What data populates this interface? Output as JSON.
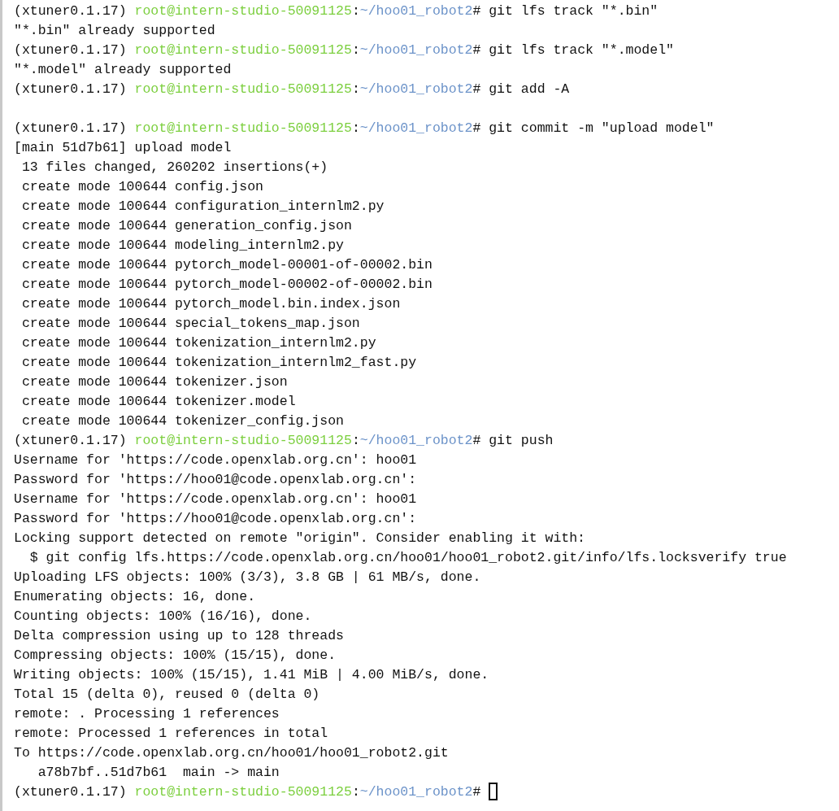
{
  "terminal": {
    "lines": [
      {
        "kind": "prompt",
        "env": "(xtuner0.1.17)",
        "user_host": "root@intern-studio-50091125",
        "separator": ":",
        "cwd": "~/hoo01_robot2",
        "symbol": "#",
        "command": "git lfs track \"*.bin\"",
        "cursor": false
      },
      {
        "kind": "output",
        "text": "\"*.bin\" already supported"
      },
      {
        "kind": "prompt",
        "env": "(xtuner0.1.17)",
        "user_host": "root@intern-studio-50091125",
        "separator": ":",
        "cwd": "~/hoo01_robot2",
        "symbol": "#",
        "command": "git lfs track \"*.model\"",
        "cursor": false
      },
      {
        "kind": "output",
        "text": "\"*.model\" already supported"
      },
      {
        "kind": "prompt",
        "env": "(xtuner0.1.17)",
        "user_host": "root@intern-studio-50091125",
        "separator": ":",
        "cwd": "~/hoo01_robot2",
        "symbol": "#",
        "command": "git add -A",
        "cursor": false
      },
      {
        "kind": "blank"
      },
      {
        "kind": "prompt",
        "env": "(xtuner0.1.17)",
        "user_host": "root@intern-studio-50091125",
        "separator": ":",
        "cwd": "~/hoo01_robot2",
        "symbol": "#",
        "command": "git commit -m \"upload model\"",
        "cursor": false
      },
      {
        "kind": "output",
        "text": "[main 51d7b61] upload model"
      },
      {
        "kind": "output",
        "text": " 13 files changed, 260202 insertions(+)"
      },
      {
        "kind": "output",
        "text": " create mode 100644 config.json"
      },
      {
        "kind": "output",
        "text": " create mode 100644 configuration_internlm2.py"
      },
      {
        "kind": "output",
        "text": " create mode 100644 generation_config.json"
      },
      {
        "kind": "output",
        "text": " create mode 100644 modeling_internlm2.py"
      },
      {
        "kind": "output",
        "text": " create mode 100644 pytorch_model-00001-of-00002.bin"
      },
      {
        "kind": "output",
        "text": " create mode 100644 pytorch_model-00002-of-00002.bin"
      },
      {
        "kind": "output",
        "text": " create mode 100644 pytorch_model.bin.index.json"
      },
      {
        "kind": "output",
        "text": " create mode 100644 special_tokens_map.json"
      },
      {
        "kind": "output",
        "text": " create mode 100644 tokenization_internlm2.py"
      },
      {
        "kind": "output",
        "text": " create mode 100644 tokenization_internlm2_fast.py"
      },
      {
        "kind": "output",
        "text": " create mode 100644 tokenizer.json"
      },
      {
        "kind": "output",
        "text": " create mode 100644 tokenizer.model"
      },
      {
        "kind": "output",
        "text": " create mode 100644 tokenizer_config.json"
      },
      {
        "kind": "prompt",
        "env": "(xtuner0.1.17)",
        "user_host": "root@intern-studio-50091125",
        "separator": ":",
        "cwd": "~/hoo01_robot2",
        "symbol": "#",
        "command": "git push",
        "cursor": false
      },
      {
        "kind": "output",
        "text": "Username for 'https://code.openxlab.org.cn': hoo01"
      },
      {
        "kind": "output",
        "text": "Password for 'https://hoo01@code.openxlab.org.cn':"
      },
      {
        "kind": "output",
        "text": "Username for 'https://code.openxlab.org.cn': hoo01"
      },
      {
        "kind": "output",
        "text": "Password for 'https://hoo01@code.openxlab.org.cn':"
      },
      {
        "kind": "output",
        "text": "Locking support detected on remote \"origin\". Consider enabling it with:"
      },
      {
        "kind": "output",
        "text": "  $ git config lfs.https://code.openxlab.org.cn/hoo01/hoo01_robot2.git/info/lfs.locksverify true"
      },
      {
        "kind": "output",
        "text": "Uploading LFS objects: 100% (3/3), 3.8 GB | 61 MB/s, done."
      },
      {
        "kind": "output",
        "text": "Enumerating objects: 16, done."
      },
      {
        "kind": "output",
        "text": "Counting objects: 100% (16/16), done."
      },
      {
        "kind": "output",
        "text": "Delta compression using up to 128 threads"
      },
      {
        "kind": "output",
        "text": "Compressing objects: 100% (15/15), done."
      },
      {
        "kind": "output",
        "text": "Writing objects: 100% (15/15), 1.41 MiB | 4.00 MiB/s, done."
      },
      {
        "kind": "output",
        "text": "Total 15 (delta 0), reused 0 (delta 0)"
      },
      {
        "kind": "output",
        "text": "remote: . Processing 1 references"
      },
      {
        "kind": "output",
        "text": "remote: Processed 1 references in total"
      },
      {
        "kind": "output",
        "text": "To https://code.openxlab.org.cn/hoo01/hoo01_robot2.git"
      },
      {
        "kind": "output",
        "text": "   a78b7bf..51d7b61  main -> main"
      },
      {
        "kind": "prompt",
        "env": "(xtuner0.1.17)",
        "user_host": "root@intern-studio-50091125",
        "separator": ":",
        "cwd": "~/hoo01_robot2",
        "symbol": "#",
        "cursor": true
      }
    ]
  }
}
